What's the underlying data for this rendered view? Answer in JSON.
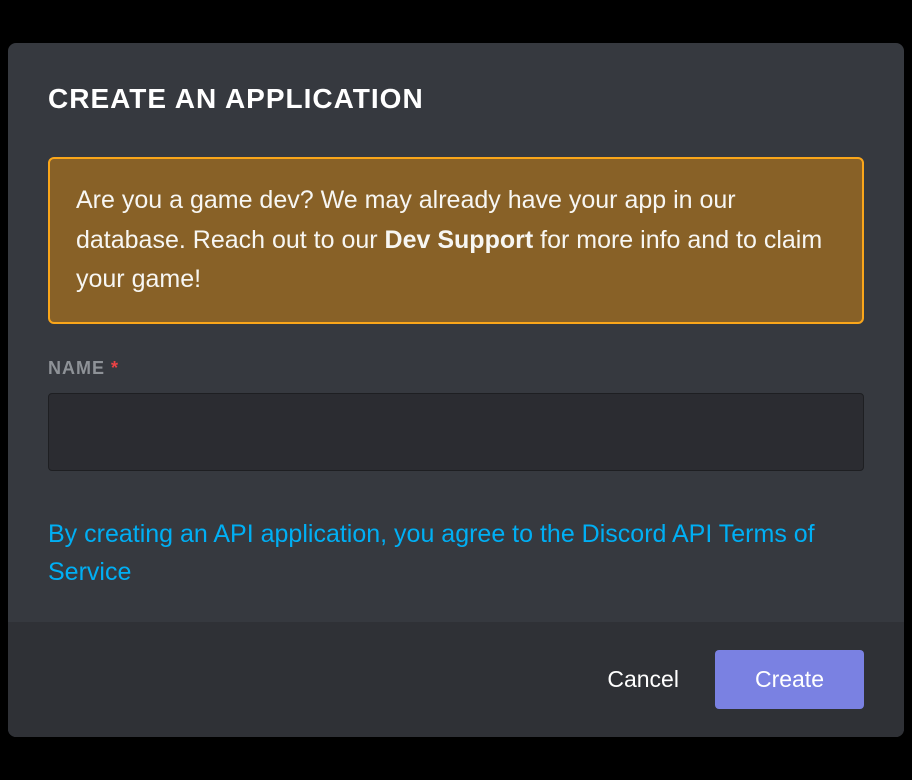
{
  "modal": {
    "title": "CREATE AN APPLICATION",
    "banner": {
      "text_before": "Are you a game dev? We may already have your app in our database. Reach out to our ",
      "bold": "Dev Support",
      "text_after": " for more info and to claim your game!"
    },
    "field": {
      "label": "NAME",
      "required_mark": "*",
      "value": ""
    },
    "terms_text": "By creating an API application, you agree to the Discord API Terms of Service",
    "footer": {
      "cancel": "Cancel",
      "create": "Create"
    }
  }
}
